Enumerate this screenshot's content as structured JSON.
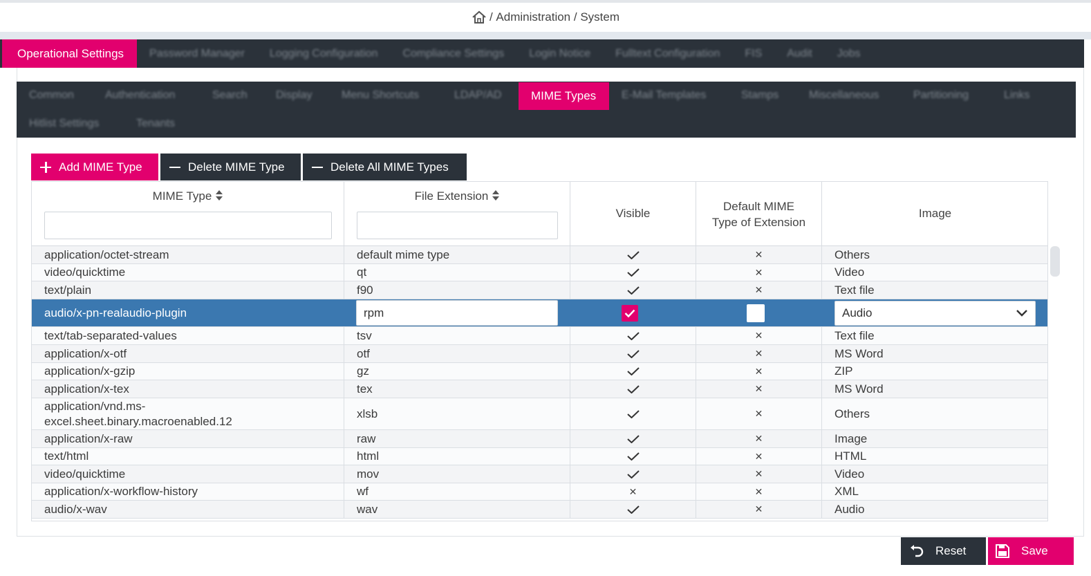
{
  "breadcrumb": {
    "home_icon": "home-icon",
    "separator": "/",
    "items": [
      "Administration",
      "System"
    ]
  },
  "main_tabs": [
    {
      "label": "Operational Settings",
      "active": true
    },
    {
      "label": "Password Manager"
    },
    {
      "label": "Logging Configuration"
    },
    {
      "label": "Compliance Settings"
    },
    {
      "label": "Login Notice"
    },
    {
      "label": "Fulltext Configuration"
    },
    {
      "label": "FIS"
    },
    {
      "label": "Audit"
    },
    {
      "label": "Jobs"
    }
  ],
  "sub_tabs": [
    {
      "label": "Common"
    },
    {
      "label": "Authentication"
    },
    {
      "label": "Search"
    },
    {
      "label": "Display"
    },
    {
      "label": "Menu Shortcuts"
    },
    {
      "label": "LDAP/AD"
    },
    {
      "label": "MIME Types",
      "active": true
    },
    {
      "label": "E-Mail Templates"
    },
    {
      "label": "Stamps"
    },
    {
      "label": "Miscellaneous"
    },
    {
      "label": "Partitioning"
    },
    {
      "label": "Links"
    },
    {
      "label": "Hitlist Settings"
    },
    {
      "label": "Tenants"
    }
  ],
  "toolbar": {
    "add_label": "Add MIME Type",
    "delete_label": "Delete MIME Type",
    "delete_all_label": "Delete All MIME Types"
  },
  "columns": {
    "mime_type": "MIME Type",
    "file_extension": "File Extension",
    "visible": "Visible",
    "default_line1": "Default MIME",
    "default_line2": "Type of Extension",
    "image": "Image"
  },
  "filters": {
    "mime_type": "",
    "file_extension": ""
  },
  "rows": [
    {
      "mime": "application/octet-stream",
      "ext": "default mime type",
      "visible": true,
      "default": false,
      "image": "Others"
    },
    {
      "mime": "video/quicktime",
      "ext": "qt",
      "visible": true,
      "default": false,
      "image": "Video"
    },
    {
      "mime": "text/plain",
      "ext": "f90",
      "visible": true,
      "default": false,
      "image": "Text file"
    },
    {
      "mime": "audio/x-pn-realaudio-plugin",
      "ext": "rpm",
      "visible": true,
      "default": false,
      "image": "Audio",
      "selected": true
    },
    {
      "mime": "text/tab-separated-values",
      "ext": "tsv",
      "visible": true,
      "default": false,
      "image": "Text file"
    },
    {
      "mime": "application/x-otf",
      "ext": "otf",
      "visible": true,
      "default": false,
      "image": "MS Word"
    },
    {
      "mime": "application/x-gzip",
      "ext": "gz",
      "visible": true,
      "default": false,
      "image": "ZIP"
    },
    {
      "mime": "application/x-tex",
      "ext": "tex",
      "visible": true,
      "default": false,
      "image": "MS Word"
    },
    {
      "mime": "application/vnd.ms-",
      "mime2": "excel.sheet.binary.macroenabled.12",
      "ext": "xlsb",
      "visible": true,
      "default": false,
      "image": "Others"
    },
    {
      "mime": "application/x-raw",
      "ext": "raw",
      "visible": true,
      "default": false,
      "image": "Image"
    },
    {
      "mime": "text/html",
      "ext": "html",
      "visible": true,
      "default": false,
      "image": "HTML"
    },
    {
      "mime": "video/quicktime",
      "ext": "mov",
      "visible": true,
      "default": false,
      "image": "Video"
    },
    {
      "mime": "application/x-workflow-history",
      "ext": "wf",
      "visible": false,
      "default": false,
      "image": "XML"
    },
    {
      "mime": "audio/x-wav",
      "ext": "wav",
      "visible": true,
      "default": false,
      "image": "Audio"
    }
  ],
  "footer": {
    "reset_label": "Reset",
    "save_label": "Save"
  },
  "colors": {
    "accent": "#e2006e",
    "dark": "#2b323a",
    "selected_row": "#3b78b0"
  }
}
